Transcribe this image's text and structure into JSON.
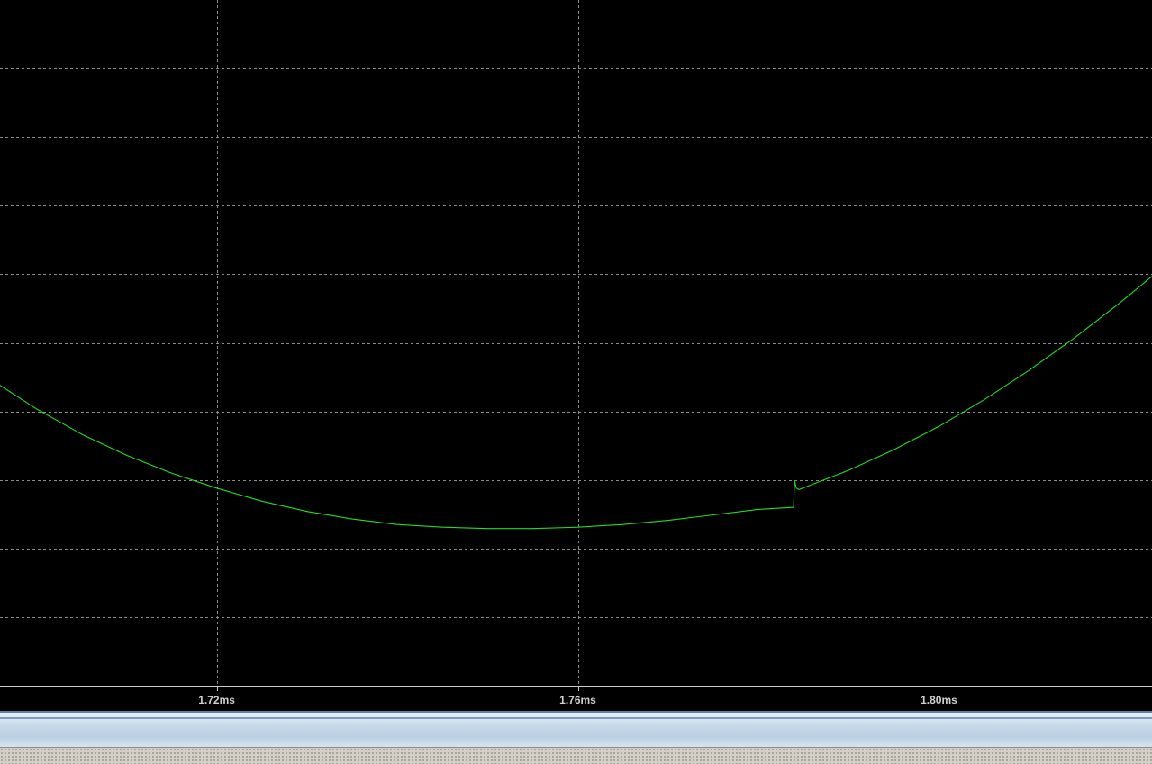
{
  "chart_data": {
    "type": "line",
    "title": "",
    "xlabel": "",
    "ylabel": "",
    "xlim": [
      1.696,
      1.8236
    ],
    "x_unit": "ms",
    "x_ticks": [
      {
        "value": 1.72,
        "label": "1.72ms"
      },
      {
        "value": 1.76,
        "label": "1.76ms"
      },
      {
        "value": 1.8,
        "label": "1.80ms"
      }
    ],
    "ylim": [
      0,
      10
    ],
    "y_gridlines": [
      1,
      2,
      3,
      4,
      5,
      6,
      7,
      8,
      9
    ],
    "grid": true,
    "background_color": "#000000",
    "grid_color": "#8c8c8c",
    "series": [
      {
        "color": "#22dd22",
        "points": [
          [
            1.696,
            4.38
          ],
          [
            1.7,
            4.04
          ],
          [
            1.705,
            3.67
          ],
          [
            1.71,
            3.36
          ],
          [
            1.715,
            3.1
          ],
          [
            1.72,
            2.88
          ],
          [
            1.725,
            2.69
          ],
          [
            1.73,
            2.54
          ],
          [
            1.735,
            2.43
          ],
          [
            1.74,
            2.35
          ],
          [
            1.745,
            2.31
          ],
          [
            1.75,
            2.29
          ],
          [
            1.755,
            2.29
          ],
          [
            1.76,
            2.31
          ],
          [
            1.765,
            2.35
          ],
          [
            1.77,
            2.41
          ],
          [
            1.775,
            2.49
          ],
          [
            1.78,
            2.57
          ],
          [
            1.7839,
            2.6
          ],
          [
            1.784,
            2.99
          ],
          [
            1.7842,
            2.88
          ],
          [
            1.7845,
            2.86
          ],
          [
            1.79,
            3.14
          ],
          [
            1.795,
            3.44
          ],
          [
            1.8,
            3.78
          ],
          [
            1.805,
            4.17
          ],
          [
            1.81,
            4.6
          ],
          [
            1.815,
            5.07
          ],
          [
            1.82,
            5.58
          ],
          [
            1.8236,
            5.97
          ]
        ]
      }
    ]
  }
}
